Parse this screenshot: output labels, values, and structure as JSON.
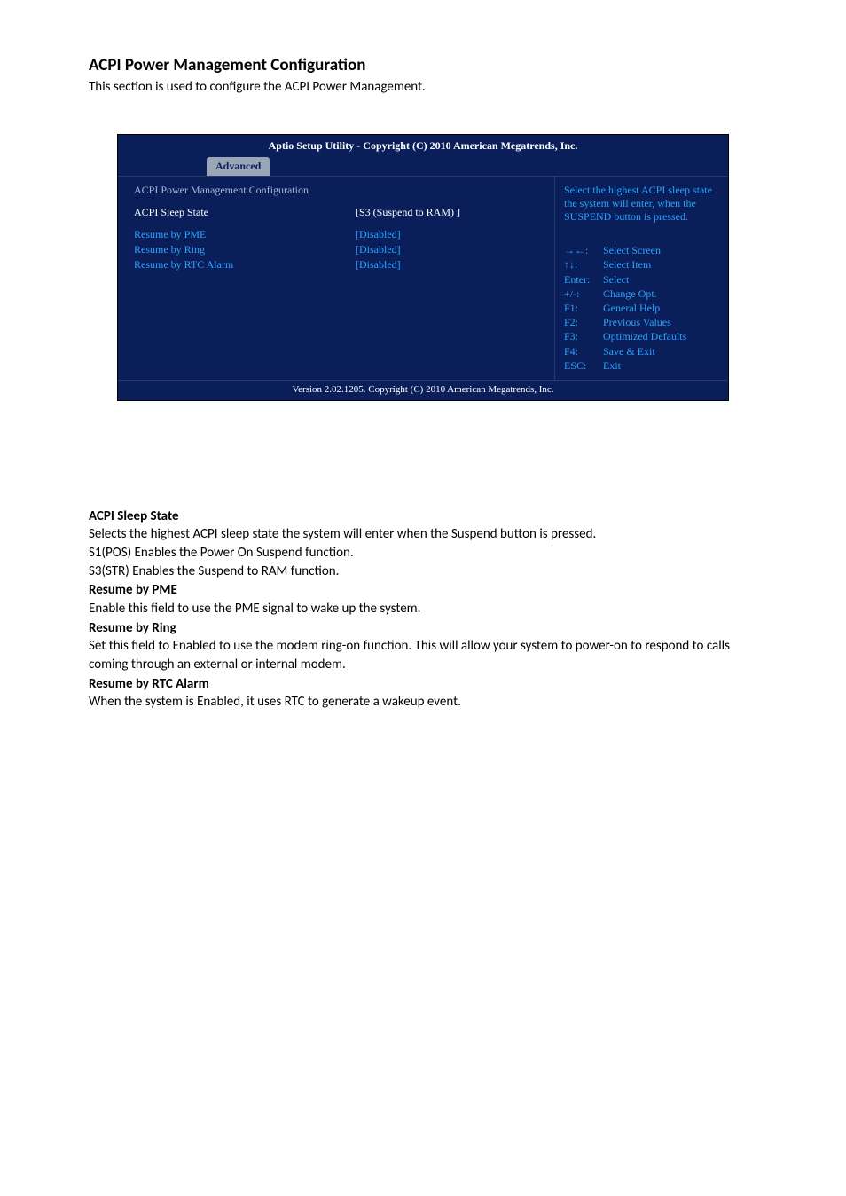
{
  "page": {
    "title": "ACPI Power Management Configuration",
    "intro": "This section is used to configure the ACPI Power Management."
  },
  "bios": {
    "titlebar": "Aptio Setup Utility - Copyright (C) 2010 American Megatrends, Inc.",
    "tab": "Advanced",
    "left": {
      "heading": "ACPI Power Management Configuration",
      "rows": [
        {
          "label": "ACPI Sleep State",
          "value": "[S3 (Suspend to RAM) ]",
          "selected": true
        },
        {
          "label": "Resume by PME",
          "value": "[Disabled]",
          "selected": false
        },
        {
          "label": "Resume by Ring",
          "value": "[Disabled]",
          "selected": false
        },
        {
          "label": "Resume by RTC Alarm",
          "value": "[Disabled]",
          "selected": false
        }
      ]
    },
    "help": "Select the highest ACPI sleep state the system will enter, when the SUSPEND button is pressed.",
    "keys": [
      {
        "k": "→←:",
        "d": "Select Screen"
      },
      {
        "k": "↑↓:",
        "d": "Select Item"
      },
      {
        "k": "Enter:",
        "d": "Select"
      },
      {
        "k": "+/-:",
        "d": "Change Opt."
      },
      {
        "k": "F1:",
        "d": "General Help"
      },
      {
        "k": "F2:",
        "d": "Previous Values"
      },
      {
        "k": "F3:",
        "d": "Optimized Defaults"
      },
      {
        "k": "F4:",
        "d": "Save & Exit"
      },
      {
        "k": "ESC:",
        "d": "Exit"
      }
    ],
    "footer": "Version 2.02.1205. Copyright (C) 2010 American Megatrends, Inc."
  },
  "descriptions": {
    "acpi_sleep_state_h": "ACPI Sleep State",
    "acpi_sleep_state_1": "Selects the highest ACPI sleep state the system will enter when the Suspend button is pressed.",
    "acpi_sleep_state_2": "S1(POS) Enables the Power On Suspend function.",
    "acpi_sleep_state_3": "S3(STR) Enables the Suspend to RAM function.",
    "resume_pme_h": "Resume by PME",
    "resume_pme_1": "Enable this field to use the PME signal to wake up the system.",
    "resume_ring_h": "Resume by Ring",
    "resume_ring_1": "Set this field to Enabled to use the modem ring-on function. This will allow your system to power-on to respond to calls coming through an external or internal modem.",
    "resume_rtc_h": "Resume by RTC Alarm",
    "resume_rtc_1": "When the system is Enabled, it uses RTC to generate a wakeup event."
  }
}
